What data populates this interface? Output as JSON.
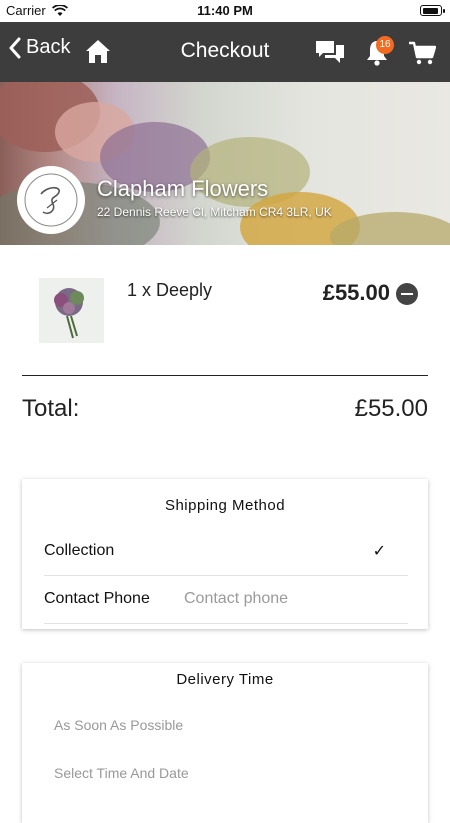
{
  "status_bar": {
    "carrier": "Carrier",
    "time": "11:40 PM"
  },
  "nav": {
    "back_label": "Back",
    "title": "Checkout",
    "notification_count": "16",
    "icons": [
      "home-icon",
      "chat-icon",
      "bell-icon",
      "cart-icon"
    ]
  },
  "shop": {
    "name": "Clapham Flowers",
    "address": "22 Dennis Reeve Cl, Mitcham CR4 3LR, UK"
  },
  "cart": {
    "items": [
      {
        "name": "1 x Deeply",
        "price": "£55.00"
      }
    ],
    "total_label": "Total:",
    "total_value": "£55.00"
  },
  "shipping": {
    "title": "Shipping Method",
    "method": "Collection",
    "method_selected": true,
    "phone_label": "Contact Phone",
    "phone_placeholder": "Contact phone"
  },
  "delivery": {
    "title": "Delivery Time",
    "options": [
      "As Soon As Possible",
      "Select Time And Date"
    ]
  },
  "colors": {
    "nav_bg": "#3d3d3d",
    "badge": "#f36b21"
  }
}
